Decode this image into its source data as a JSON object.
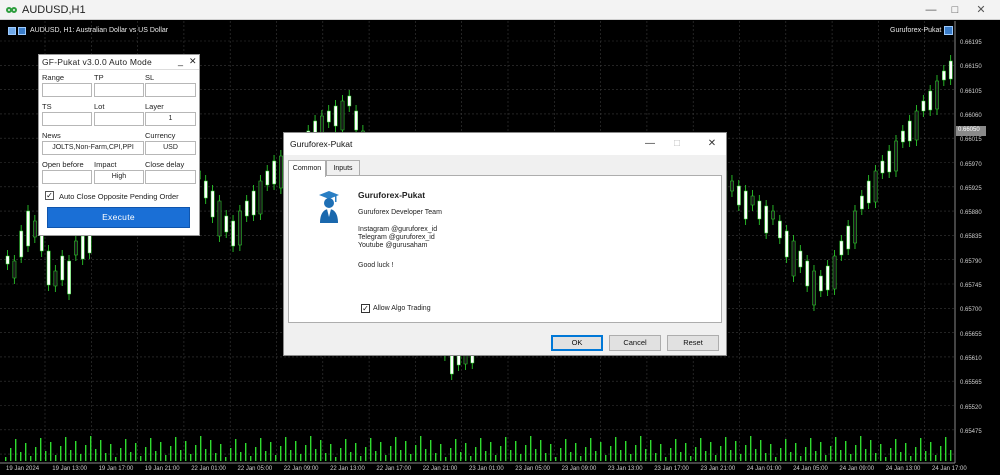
{
  "window": {
    "title": "AUDUSD,H1"
  },
  "chart": {
    "header": "AUDUSD, H1:  Australian Dollar vs US Dollar",
    "ea_corner_label": "Guruforex-Pukat",
    "current_price": "0.66050",
    "price_labels": [
      "0.66195",
      "0.66150",
      "0.66105",
      "0.66060",
      "0.66015",
      "0.65970",
      "0.65925",
      "0.65880",
      "0.65835",
      "0.65790",
      "0.65745",
      "0.65700",
      "0.65655",
      "0.65610",
      "0.65565",
      "0.65520",
      "0.65475"
    ],
    "time_labels": [
      "19 Jan 2024",
      "19 Jan 13:00",
      "19 Jan 17:00",
      "19 Jan 21:00",
      "22 Jan 01:00",
      "22 Jan 05:00",
      "22 Jan 09:00",
      "22 Jan 13:00",
      "22 Jan 17:00",
      "22 Jan 21:00",
      "23 Jan 01:00",
      "23 Jan 05:00",
      "23 Jan 09:00",
      "23 Jan 13:00",
      "23 Jan 17:00",
      "23 Jan 21:00",
      "24 Jan 01:00",
      "24 Jan 05:00",
      "24 Jan 09:00",
      "24 Jan 13:00",
      "24 Jan 17:00"
    ],
    "colors": {
      "bull": "#ffffff",
      "bear": "#1a1a1a",
      "wick": "#2fdc2f",
      "grid": "#3a3a3a",
      "volume": "#2fdc2f"
    }
  },
  "ea_panel": {
    "title": "GF-Pukat v3.0.0 Auto Mode",
    "minimize_icon": "_",
    "close_icon": "✕",
    "labels": {
      "range": "Range",
      "tp": "TP",
      "sl": "SL",
      "ts": "TS",
      "lot": "Lot",
      "layer": "Layer",
      "news": "News",
      "currency": "Currency",
      "open_before": "Open before",
      "impact": "Impact",
      "close_delay": "Close delay"
    },
    "values": {
      "range": "",
      "tp": "",
      "sl": "",
      "ts": "",
      "lot": "",
      "layer": "1",
      "news": "JOLTS,Non-Farm,CPI,PPI",
      "currency": "USD",
      "open_before": "",
      "impact": "High",
      "close_delay": ""
    },
    "auto_close_label": "Auto Close Opposite Pending Order",
    "auto_close_checked": true,
    "execute_label": "Execute"
  },
  "dialog": {
    "title": "Guruforex-Pukat",
    "tabs": [
      "Common",
      "Inputs"
    ],
    "active_tab": "Common",
    "name": "Guruforex-Pukat",
    "team": "Guruforex Developer Team",
    "instagram": "Instagram @guruforex_id",
    "telegram": "Telegram @guruforex_id",
    "youtube": "Youtube @gurusaham",
    "good_luck": "Good luck !",
    "allow_algo_label": "Allow Algo Trading",
    "allow_algo_checked": true,
    "buttons": {
      "ok": "OK",
      "cancel": "Cancel",
      "reset": "Reset"
    }
  }
}
